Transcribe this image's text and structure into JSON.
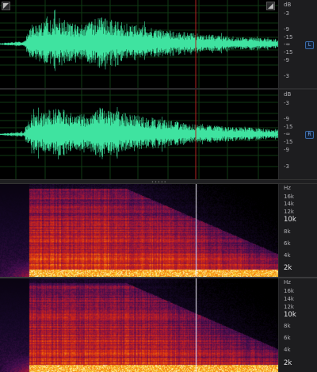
{
  "waveform": {
    "ruler_labels": [
      "dB",
      "-3",
      "-9",
      "-15",
      "-∞",
      "-15",
      "-9",
      "-3"
    ],
    "channels": [
      {
        "name": "left",
        "badge": "L",
        "ruler": [
          "dB",
          "-3",
          "-9",
          "-15",
          "-∞",
          "-15",
          "-9",
          "-3"
        ]
      },
      {
        "name": "right",
        "badge": "R",
        "ruler": [
          "dB",
          "-3",
          "-9",
          "-15",
          "-∞",
          "-15",
          "-9",
          "-3"
        ]
      }
    ],
    "wave_color": "#3fe3a0",
    "playhead_color": "#b22222",
    "grid_color": "#0f3a14"
  },
  "divider": {
    "grip": "•••••"
  },
  "spectrogram": {
    "channels": [
      {
        "ruler": [
          "Hz",
          "16k",
          "14k",
          "12k",
          "10k",
          "8k",
          "6k",
          "4k",
          "2k",
          "1k"
        ]
      },
      {
        "ruler": [
          "Hz",
          "16k",
          "14k",
          "12k",
          "10k",
          "8k",
          "6k",
          "4k",
          "2k",
          "1k"
        ]
      }
    ],
    "cursor_color": "#f4f0ff"
  },
  "toolbar": {
    "zoom_left_icon": "zoom-out-corner-icon",
    "zoom_right_icon": "zoom-in-corner-icon"
  }
}
